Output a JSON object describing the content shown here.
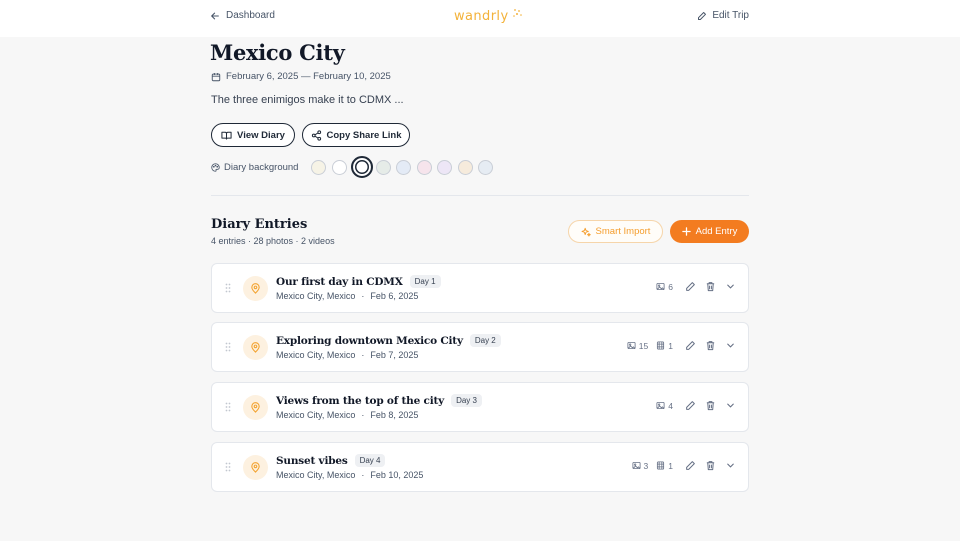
{
  "header": {
    "back_label": "Dashboard",
    "logo_text": "wandrly",
    "edit_label": "Edit Trip"
  },
  "trip": {
    "title": "Mexico City",
    "dates": "February 6, 2025 — February 10, 2025",
    "description": "The three enimigos make it to CDMX ..."
  },
  "buttons": {
    "view_diary": "View Diary",
    "copy_share": "Copy Share Link"
  },
  "background": {
    "label": "Diary background",
    "swatches": [
      "#f6f3e6",
      "#ffffff",
      "#ffffff",
      "#e6ece8",
      "#e4ebf6",
      "#f6e4ec",
      "#ede6f6",
      "#f6ebdc",
      "#e6ecf3"
    ],
    "selected_index": 2
  },
  "diary": {
    "title": "Diary Entries",
    "meta": "4 entries · 28 photos · 2 videos",
    "smart_import": "Smart Import",
    "add_entry": "Add Entry"
  },
  "colors": {
    "accent": "#f37c20",
    "logo": "#f3b23a"
  },
  "entries": [
    {
      "title": "Our first day in CDMX",
      "day": "Day 1",
      "location": "Mexico City, Mexico",
      "date": "Feb 6, 2025",
      "photos": "6",
      "videos": ""
    },
    {
      "title": "Exploring downtown Mexico City",
      "day": "Day 2",
      "location": "Mexico City, Mexico",
      "date": "Feb 7, 2025",
      "photos": "15",
      "videos": "1"
    },
    {
      "title": "Views from the top of the city",
      "day": "Day 3",
      "location": "Mexico City, Mexico",
      "date": "Feb 8, 2025",
      "photos": "4",
      "videos": ""
    },
    {
      "title": "Sunset vibes",
      "day": "Day 4",
      "location": "Mexico City, Mexico",
      "date": "Feb 10, 2025",
      "photos": "3",
      "videos": "1"
    }
  ]
}
